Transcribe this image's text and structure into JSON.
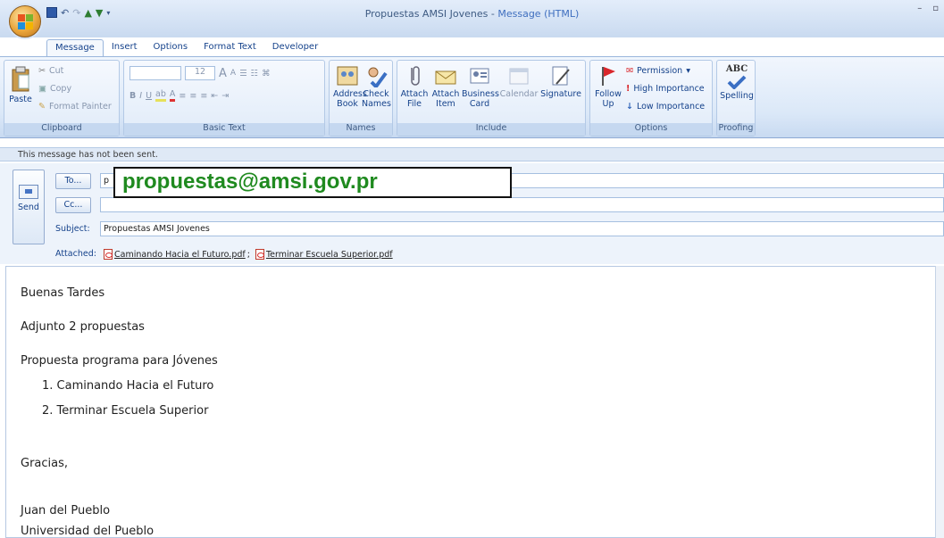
{
  "window": {
    "title": "Propuestas AMSI Jovenes",
    "title_sep": " - ",
    "title_type": "Message (HTML)"
  },
  "qat": {
    "save_icon": "save-icon",
    "undo_icon": "undo-icon",
    "redo_icon": "redo-icon",
    "up_icon": "arrow-up-icon",
    "down_icon": "arrow-down-icon"
  },
  "tabs": [
    "Message",
    "Insert",
    "Options",
    "Format Text",
    "Developer"
  ],
  "ribbon": {
    "clipboard": {
      "caption": "Clipboard",
      "paste": "Paste",
      "cut": "Cut",
      "copy": "Copy",
      "format_painter": "Format Painter"
    },
    "basic_text": {
      "caption": "Basic Text",
      "font_size": "12",
      "bold": "B",
      "italic": "I",
      "underline": "U",
      "grow": "A",
      "shrink": "A"
    },
    "names": {
      "caption": "Names",
      "address_book_1": "Address",
      "address_book_2": "Book",
      "check_names_1": "Check",
      "check_names_2": "Names"
    },
    "include": {
      "caption": "Include",
      "attach_file_1": "Attach",
      "attach_file_2": "File",
      "attach_item_1": "Attach",
      "attach_item_2": "Item",
      "business_card_1": "Business",
      "business_card_2": "Card",
      "calendar": "Calendar",
      "signature": "Signature"
    },
    "options": {
      "caption": "Options",
      "follow_up_1": "Follow",
      "follow_up_2": "Up",
      "permission": "Permission",
      "high_importance": "High Importance",
      "low_importance": "Low Importance"
    },
    "proofing": {
      "caption": "Proofing",
      "spelling": "Spelling",
      "abc": "ABC"
    }
  },
  "status": "This message has not been sent.",
  "header": {
    "send": "Send",
    "to_button": "To...",
    "cc_button": "Cc...",
    "to_value": "propuestas@amsi.gov.pr",
    "to_prefix": "p",
    "cc_value": "",
    "subject_label": "Subject:",
    "subject_value": "Propuestas AMSI Jovenes",
    "attached_label": "Attached:",
    "attachments": [
      "Caminando Hacia el Futuro.pdf",
      "Terminar Escuela Superior.pdf"
    ],
    "attach_sep": ";"
  },
  "body": {
    "greeting": "Buenas Tardes",
    "line1": "Adjunto 2 propuestas",
    "line2": "Propuesta programa para Jóvenes",
    "list": [
      "1. Caminando Hacia el Futuro",
      "2. Terminar Escuela Superior"
    ],
    "closing": "Gracias,",
    "name": "Juan del Pueblo",
    "org": "Universidad del Pueblo"
  },
  "colors": {
    "accent": "#15428b",
    "to_overlay_text": "#1f8a1f",
    "ribbon_bg": "#dbe8f8"
  }
}
